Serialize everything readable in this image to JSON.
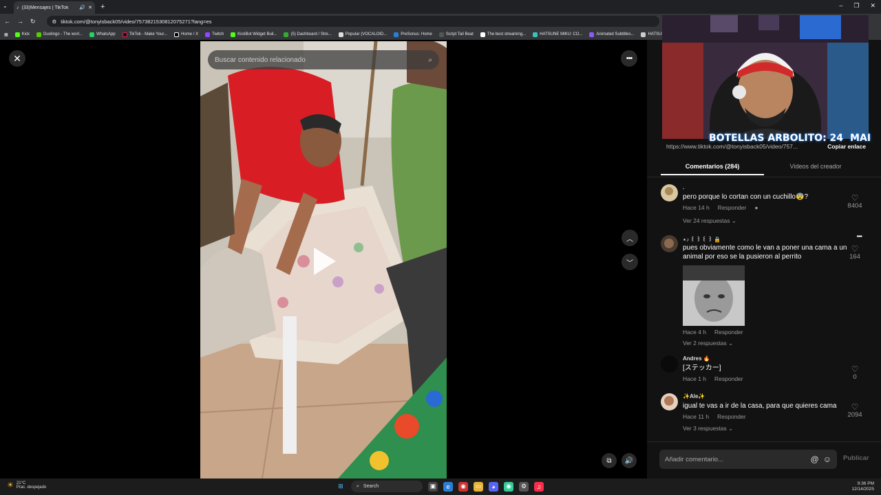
{
  "browser": {
    "tab_title": "(33)Mensajes | TikTok",
    "url": "tiktok.com/@tonyisback05/video/7573821530812075271?lang=es",
    "bookmarks": [
      "Kick",
      "Duolingo - The worl...",
      "WhatsApp",
      "TikTok - Make Your...",
      "Home / X",
      "Twitch",
      "KickBot Widget Buil...",
      "(5) Dashboard / Stre...",
      "Popular (VOCALOID...",
      "PreSonus: Home",
      "Script Tail Beat",
      "The best streaming...",
      "HATSUNE MIKU: CO...",
      "Animated Subtitles...",
      "HATSUNE M"
    ]
  },
  "video": {
    "search_placeholder": "Buscar contenido relacionado"
  },
  "overlay": {
    "counter_label": "BOTELLAS ARBOLITO: 24",
    "logo_text": "MAI"
  },
  "share": {
    "link": "https://www.tiktok.com/@tonyisback05/video/757...",
    "copy_label": "Copiar enlace"
  },
  "tabs": {
    "comments": "Comentarios (284)",
    "creator_videos": "Videos del creador"
  },
  "comments": [
    {
      "user": ".",
      "text": "pero porque lo cortan con un cuchillo😨?",
      "time": "Hace 14 h",
      "reply": "Responder",
      "likes": "8404",
      "replies": "Ver 24 respuestas ⌄"
    },
    {
      "user": "⋆♪ ꒰ ꒱ ꒰ ꒱ 🔒",
      "text": "pues obviamente como le van a poner una cama a un animal por eso se la pusieron al perrito",
      "time": "Hace 4 h",
      "reply": "Responder",
      "likes": "164",
      "replies": "Ver 2 respuestas ⌄"
    },
    {
      "user": "Andres 🔥",
      "text": "[ステッカー]",
      "time": "Hace 1 h",
      "reply": "Responder",
      "likes": "0",
      "replies": ""
    },
    {
      "user": "✨Ale✨",
      "text": "igual te vas a ir de la casa, para que quieres cama",
      "time": "Hace 11 h",
      "reply": "Responder",
      "likes": "2094",
      "replies": "Ver 3 respuestas ⌄"
    }
  ],
  "compose": {
    "placeholder": "Añadir comentario...",
    "post_label": "Publicar"
  },
  "taskbar": {
    "temp": "21°C",
    "weather": "Prac. despejado",
    "search": "Search",
    "time": "9:36 PM",
    "date": "12/14/2025"
  }
}
